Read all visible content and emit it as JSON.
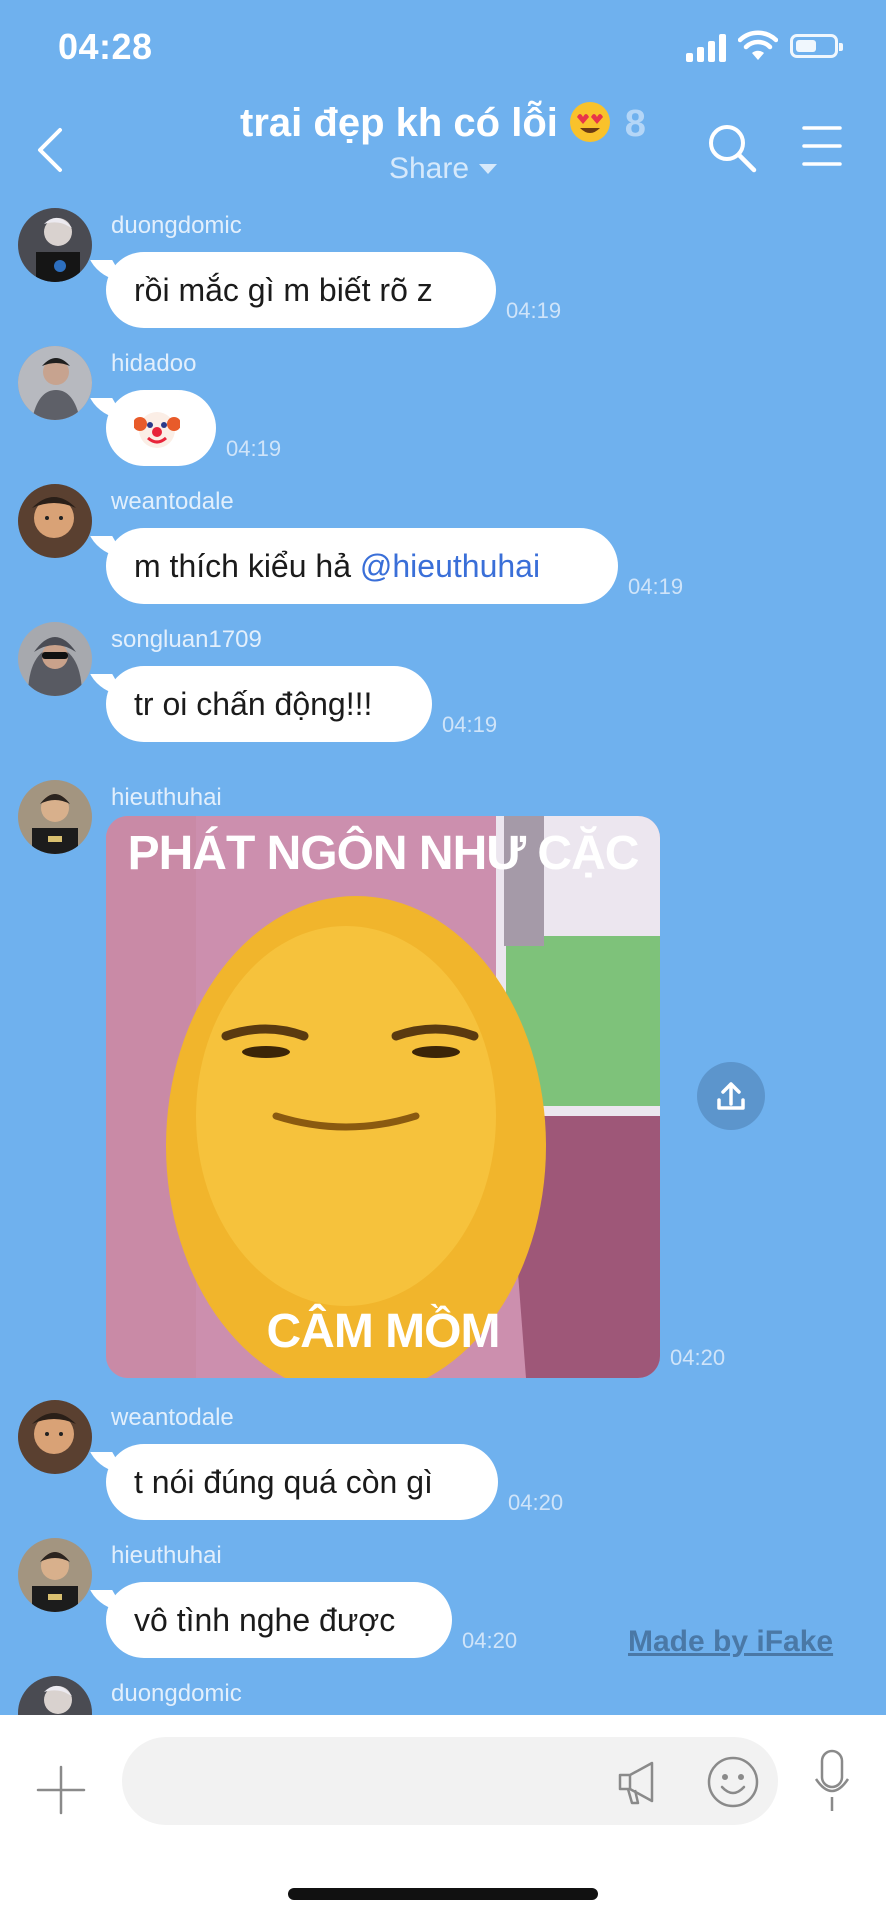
{
  "status": {
    "time": "04:28",
    "battery_level": 0.55
  },
  "header": {
    "title": "trai đẹp kh có lỗi",
    "member_count": "8",
    "subtitle": "Share"
  },
  "messages": [
    {
      "sender": "duongdomic",
      "text": "rồi mắc gì m biết rõ z",
      "time": "04:19"
    },
    {
      "sender": "hidadoo",
      "emoji": "clown-face-icon",
      "time": "04:19"
    },
    {
      "sender": "weantodale",
      "text": "m thích kiểu hả ",
      "mention": "@hieuthuhai",
      "time": "04:19"
    },
    {
      "sender": "songluan1709",
      "text": "tr oi chấn động!!!",
      "time": "04:19"
    },
    {
      "sender": "hieuthuhai",
      "image_top_text": "PHÁT NGÔN NHƯ CẶC",
      "image_bottom_text": "CÂM MỒM",
      "time": "04:20"
    },
    {
      "sender": "weantodale",
      "text": "t nói đúng quá còn gì",
      "time": "04:20"
    },
    {
      "sender": "hieuthuhai",
      "text": "vô tình nghe được",
      "time": "04:20"
    },
    {
      "sender": "duongdomic"
    }
  ],
  "watermark": "Made by iFake",
  "input": {
    "placeholder": ""
  },
  "colors": {
    "background": "#6fb1ee",
    "bubble": "#ffffff",
    "mention": "#3a6fd8",
    "input_bar": "#ffffff"
  }
}
